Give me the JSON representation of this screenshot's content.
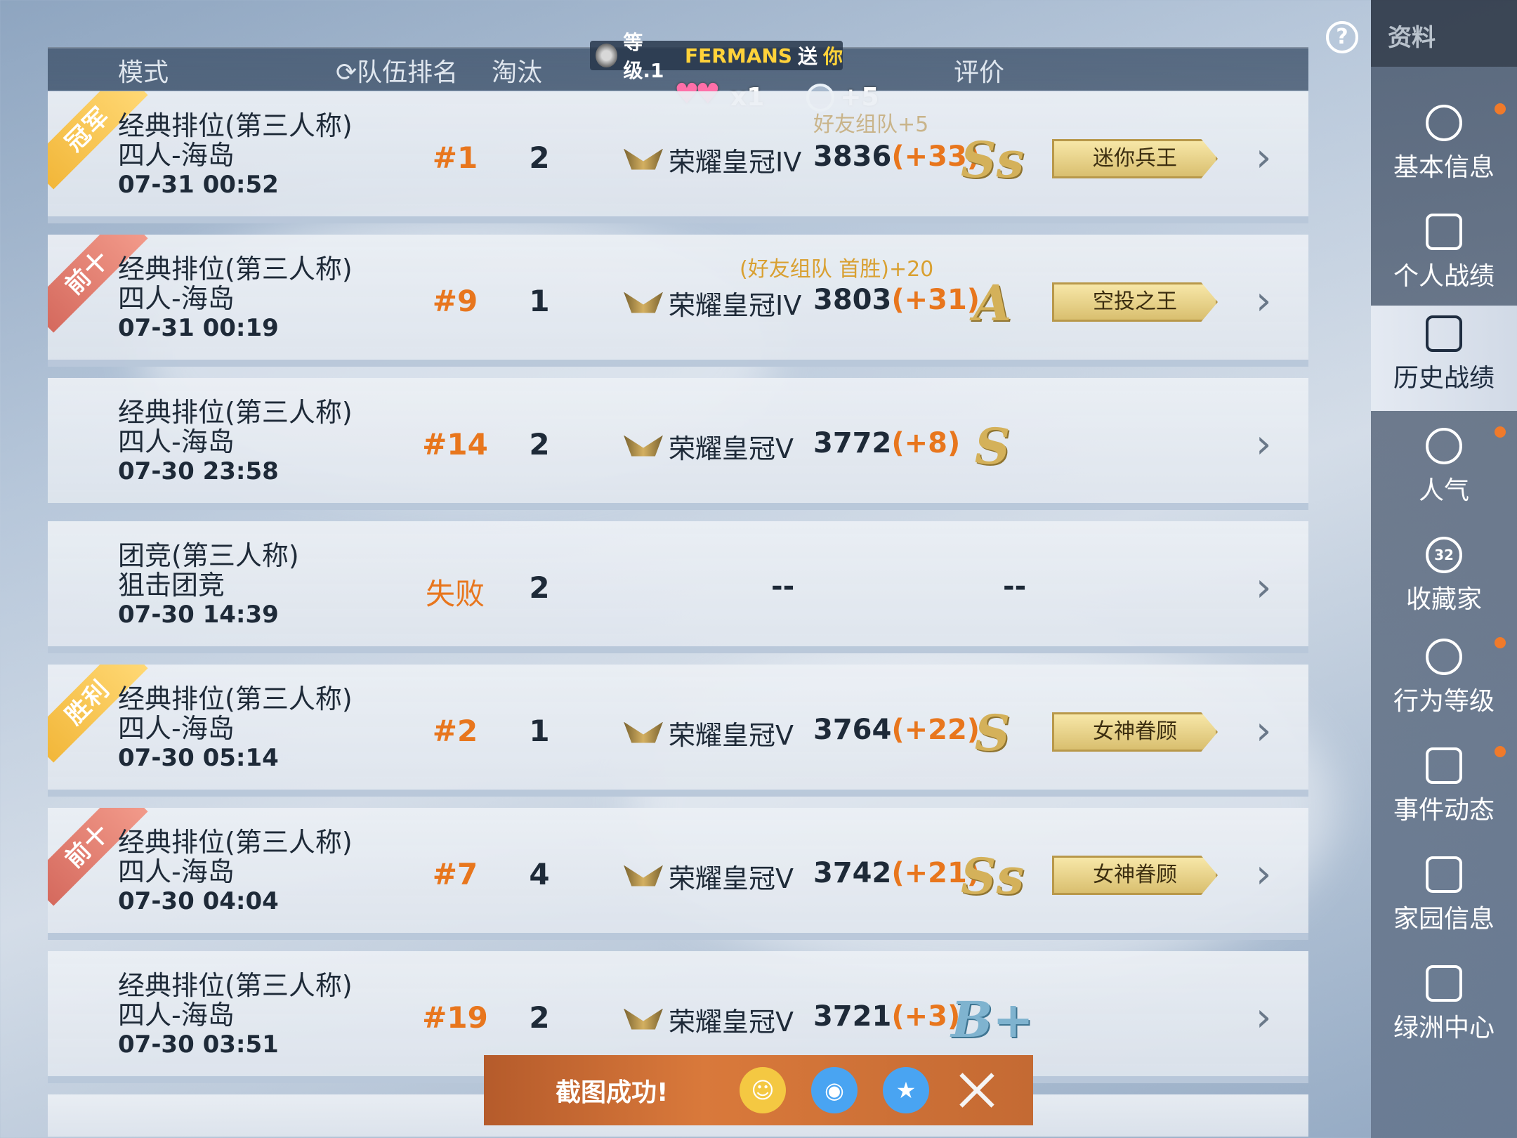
{
  "header": {
    "mode": "模式",
    "team_rank": "队伍排名",
    "kills": "淘汰",
    "rating": "评价"
  },
  "gift": {
    "level": "等级.1",
    "sender": "FERMANS",
    "send": "送",
    "to": "你"
  },
  "popularity": {
    "hearts": "x1",
    "rose": "+5"
  },
  "rows": [
    {
      "ribbon": "冠军",
      "mode": "经典排位(第三人称)",
      "map": "四人-海岛",
      "time": "07-31 00:52",
      "rank": "#1",
      "kills": "2",
      "tier": "荣耀皇冠IV",
      "score": "3836",
      "delta": "(+33)",
      "bonus": "好友组队+5",
      "grade": "Ss",
      "badge": "迷你兵王"
    },
    {
      "ribbon": "前十",
      "mode": "经典排位(第三人称)",
      "map": "四人-海岛",
      "time": "07-31 00:19",
      "rank": "#9",
      "kills": "1",
      "tier": "荣耀皇冠IV",
      "score": "3803",
      "delta": "(+31)",
      "bonus": "(好友组队 首胜)+20",
      "grade": "A",
      "badge": "空投之王"
    },
    {
      "ribbon": "",
      "mode": "经典排位(第三人称)",
      "map": "四人-海岛",
      "time": "07-30 23:58",
      "rank": "#14",
      "kills": "2",
      "tier": "荣耀皇冠V",
      "score": "3772",
      "delta": "(+8)",
      "bonus": "",
      "grade": "S",
      "badge": ""
    },
    {
      "ribbon": "",
      "mode": "团竞(第三人称)",
      "map": "狙击团竞",
      "time": "07-30 14:39",
      "rank": "失败",
      "kills": "2",
      "tier_dash": "--",
      "grade_dash": "--"
    },
    {
      "ribbon": "胜利",
      "mode": "经典排位(第三人称)",
      "map": "四人-海岛",
      "time": "07-30 05:14",
      "rank": "#2",
      "kills": "1",
      "tier": "荣耀皇冠V",
      "score": "3764",
      "delta": "(+22)",
      "bonus": "",
      "grade": "S",
      "badge": "女神眷顾"
    },
    {
      "ribbon": "前十",
      "mode": "经典排位(第三人称)",
      "map": "四人-海岛",
      "time": "07-30 04:04",
      "rank": "#7",
      "kills": "4",
      "tier": "荣耀皇冠V",
      "score": "3742",
      "delta": "(+21)",
      "bonus": "",
      "grade": "Ss",
      "badge": "女神眷顾"
    },
    {
      "ribbon": "",
      "mode": "经典排位(第三人称)",
      "map": "四人-海岛",
      "time": "07-30 03:51",
      "rank": "#19",
      "kills": "2",
      "tier": "荣耀皇冠V",
      "score": "3721",
      "delta": "(+3)",
      "bonus": "",
      "grade": "B+",
      "badge": ""
    }
  ],
  "top": {
    "tab_label": "资料"
  },
  "sidebar": {
    "items": [
      {
        "label": "基本信息",
        "icon": "profile-icon",
        "dot": true
      },
      {
        "label": "个人战绩",
        "icon": "stats-doc-icon",
        "dot": false
      },
      {
        "label": "历史战绩",
        "icon": "history-doc-icon",
        "dot": false,
        "active": true
      },
      {
        "label": "人气",
        "icon": "rose-icon",
        "dot": true
      },
      {
        "label": "收藏家",
        "icon": "collector-badge-icon",
        "dot": false,
        "badge": "32"
      },
      {
        "label": "行为等级",
        "icon": "shield-star-icon",
        "dot": true
      },
      {
        "label": "事件动态",
        "icon": "notepad-icon",
        "dot": true
      },
      {
        "label": "家园信息",
        "icon": "home-icon",
        "dot": false
      },
      {
        "label": "绿洲中心",
        "icon": "id-card-icon",
        "dot": false
      }
    ]
  },
  "toast": {
    "message": "截图成功!"
  },
  "colors": {
    "accent_orange": "#e8761d",
    "gold": "#d4b15a",
    "sidebar_bg": "#374a5c"
  }
}
